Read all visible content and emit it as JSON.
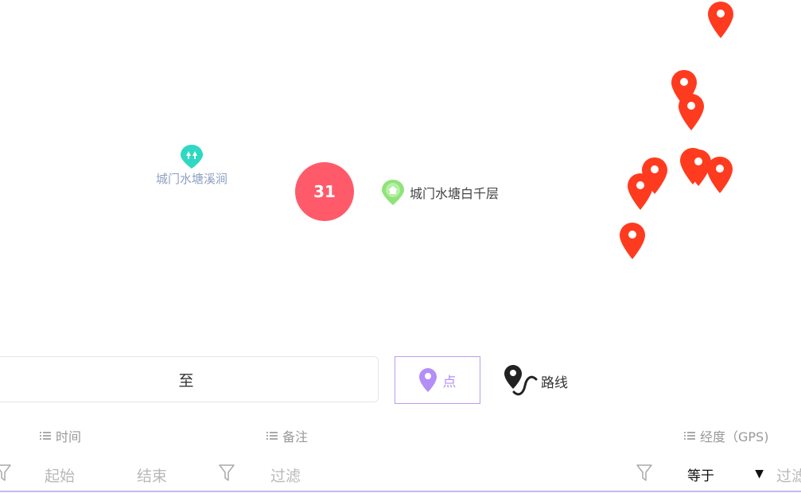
{
  "map": {
    "pois": [
      {
        "name": "城门水塘溪涧",
        "icon": "park-icon",
        "color": "#2ed8c3"
      },
      {
        "name": "城门水塘白千层",
        "icon": "house-icon",
        "color": "#8fe37a"
      }
    ],
    "cluster": {
      "count": "31",
      "color": "#ff5a6a"
    },
    "marker_color": "#ff3b1f"
  },
  "controls": {
    "range_separator": "至",
    "mode_point_label": "点",
    "mode_route_label": "路线",
    "accent": "#b48ef7"
  },
  "table": {
    "columns": {
      "time": "时间",
      "note": "备注",
      "longitude": "经度（GPS)"
    },
    "filters": {
      "start": "起始",
      "end": "结束",
      "filter": "过滤",
      "operator": "等于",
      "trailing": "过滤"
    }
  }
}
